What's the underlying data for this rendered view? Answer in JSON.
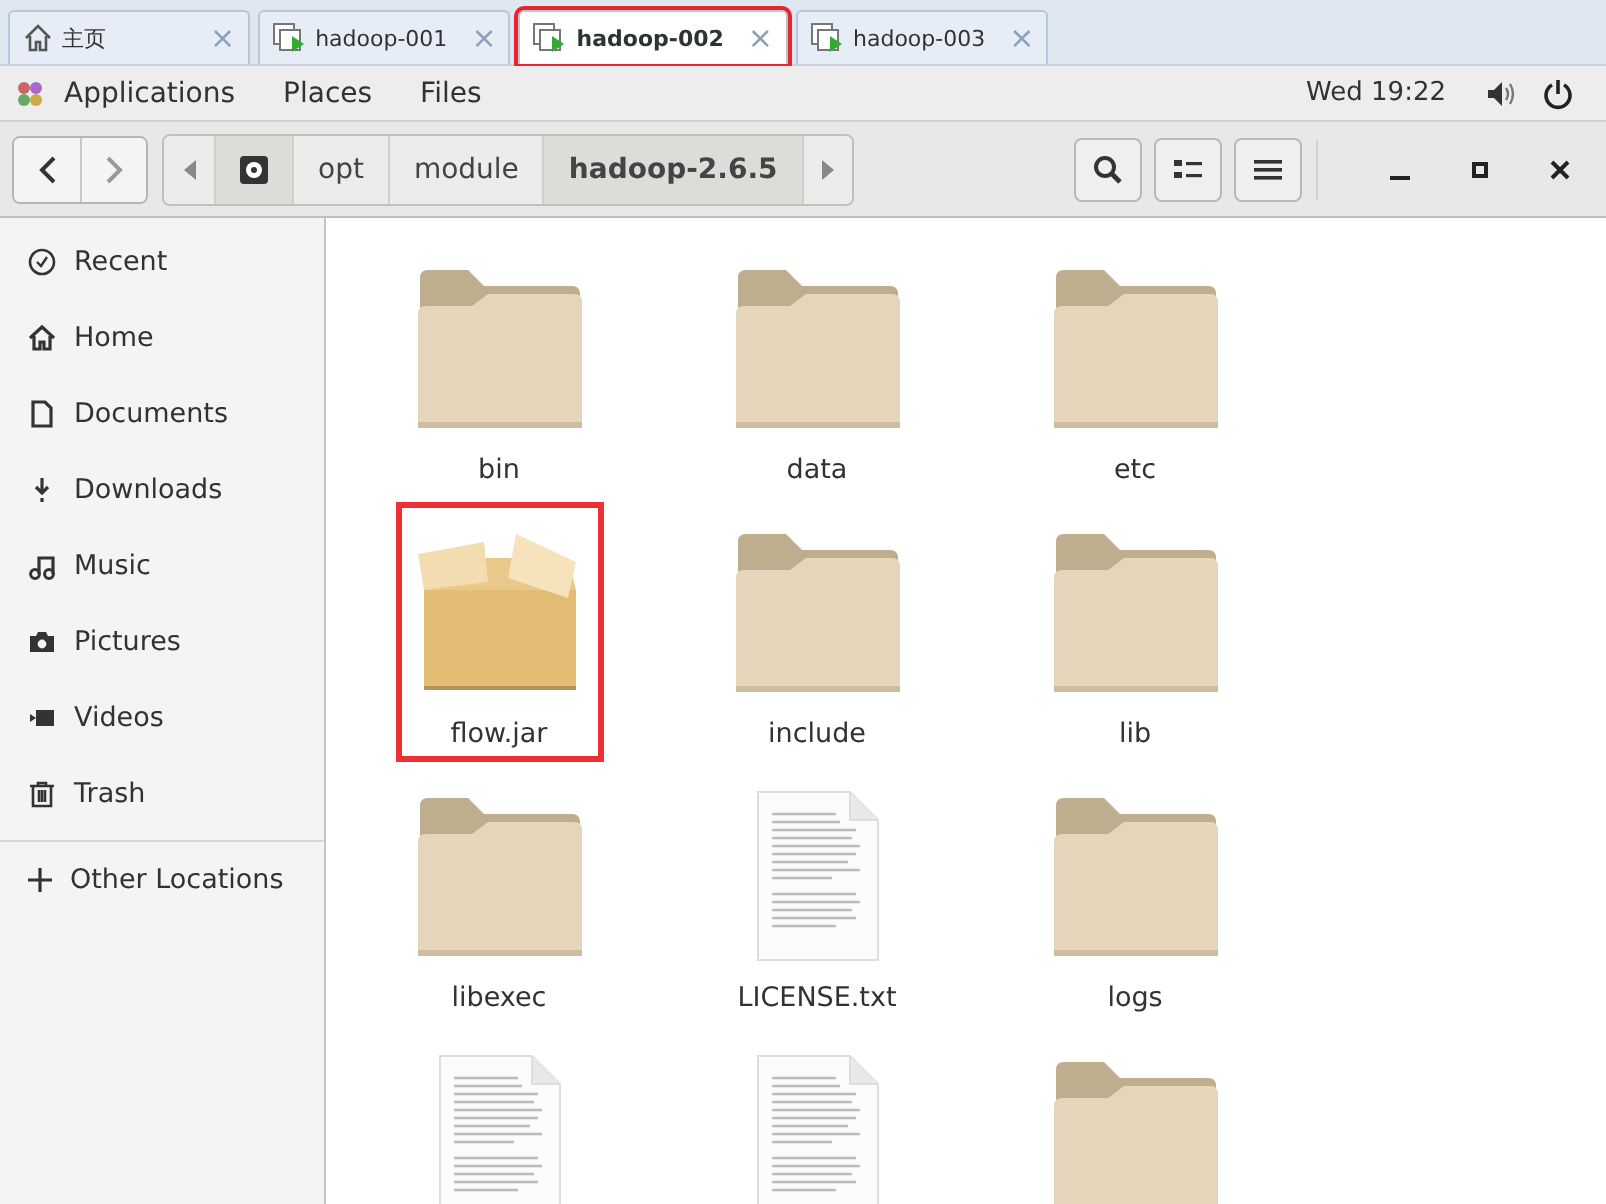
{
  "tabs": [
    {
      "label": "主页",
      "kind": "home",
      "selected": false,
      "highlighted": false
    },
    {
      "label": "hadoop-001",
      "kind": "vm",
      "selected": false,
      "highlighted": false
    },
    {
      "label": "hadoop-002",
      "kind": "vm",
      "selected": true,
      "highlighted": true
    },
    {
      "label": "hadoop-003",
      "kind": "vm",
      "selected": false,
      "highlighted": false
    }
  ],
  "tab_close": "×",
  "top_bar": {
    "menus": [
      "Applications",
      "Places",
      "Files"
    ],
    "clock": "Wed 19:22"
  },
  "path_bar": {
    "segments": [
      {
        "label": "opt",
        "selected": false
      },
      {
        "label": "module",
        "selected": false
      },
      {
        "label": "hadoop-2.6.5",
        "selected": true
      }
    ]
  },
  "sidebar": {
    "items": [
      {
        "label": "Recent",
        "kind": "recent"
      },
      {
        "label": "Home",
        "kind": "home"
      },
      {
        "label": "Documents",
        "kind": "documents"
      },
      {
        "label": "Downloads",
        "kind": "downloads"
      },
      {
        "label": "Music",
        "kind": "music"
      },
      {
        "label": "Pictures",
        "kind": "pictures"
      },
      {
        "label": "Videos",
        "kind": "videos"
      },
      {
        "label": "Trash",
        "kind": "trash"
      }
    ],
    "other": {
      "label": "Other Locations",
      "kind": "plus"
    }
  },
  "files": [
    {
      "name": "bin",
      "kind": "folder",
      "highlighted": false
    },
    {
      "name": "data",
      "kind": "folder",
      "highlighted": false
    },
    {
      "name": "etc",
      "kind": "folder",
      "highlighted": false
    },
    {
      "name": "flow.jar",
      "kind": "jar",
      "highlighted": true
    },
    {
      "name": "include",
      "kind": "folder",
      "highlighted": false
    },
    {
      "name": "lib",
      "kind": "folder",
      "highlighted": false
    },
    {
      "name": "libexec",
      "kind": "folder",
      "highlighted": false
    },
    {
      "name": "LICENSE.txt",
      "kind": "text",
      "highlighted": false
    },
    {
      "name": "logs",
      "kind": "folder",
      "highlighted": false
    },
    {
      "kind": "text",
      "highlighted": false
    },
    {
      "kind": "text",
      "highlighted": false
    },
    {
      "kind": "folder",
      "highlighted": false
    }
  ]
}
